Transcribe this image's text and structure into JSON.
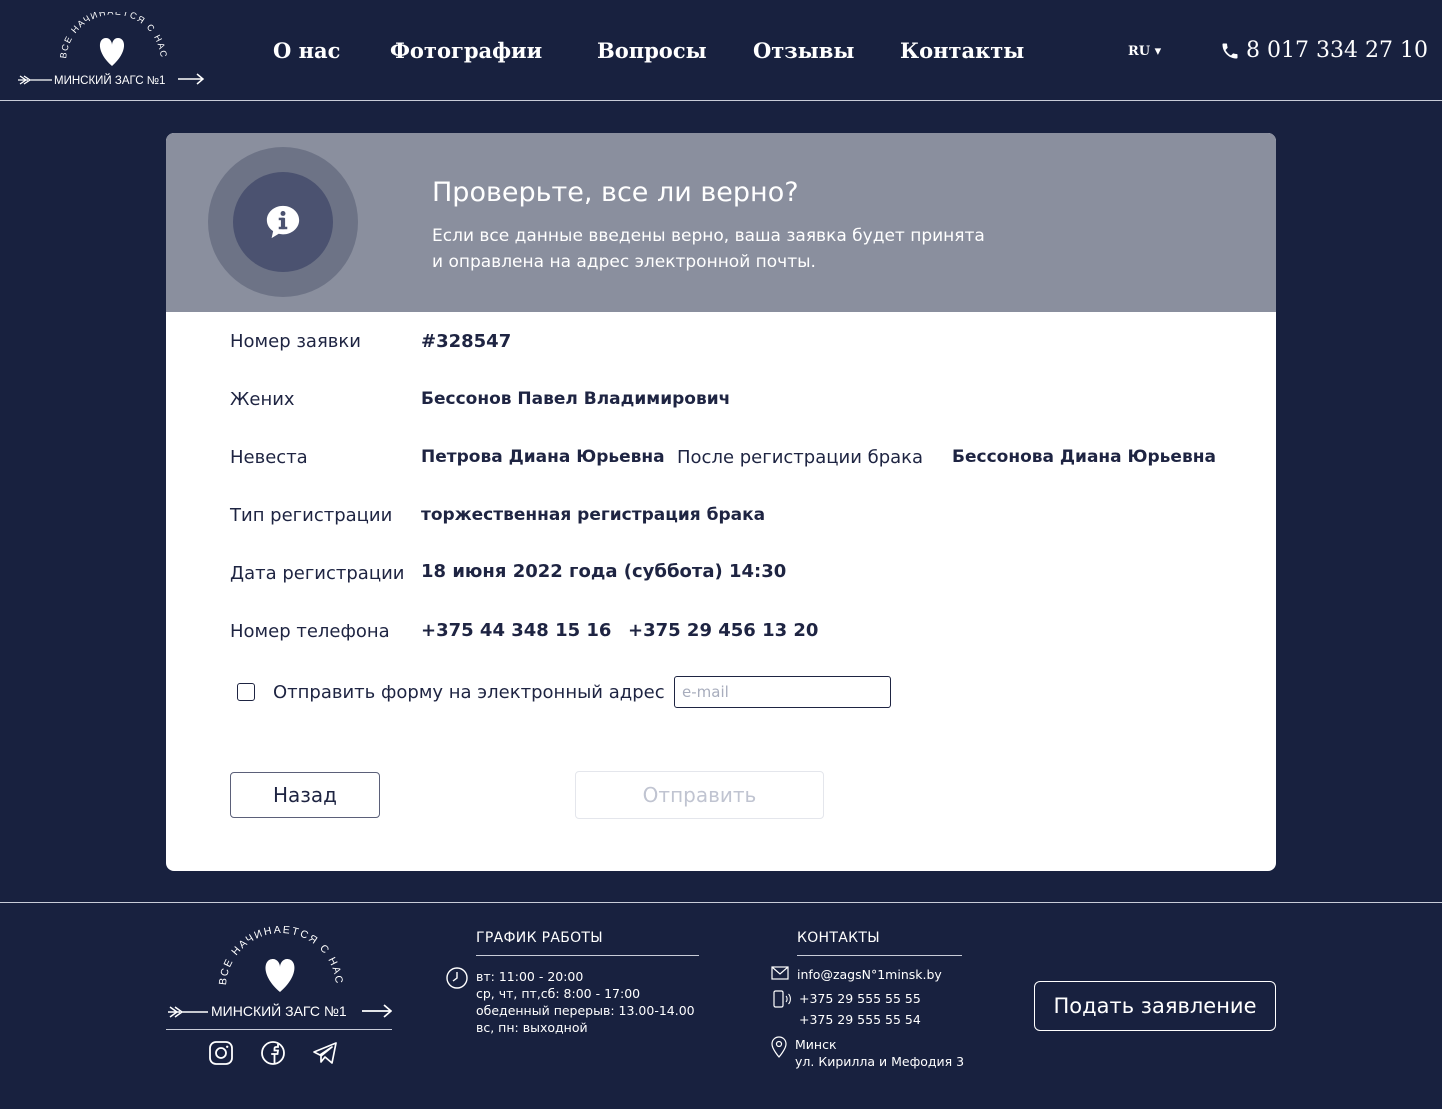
{
  "header": {
    "logo": {
      "top_text": "ВСЕ НАЧИНАЕТСЯ С НАС",
      "name": "МИНСКИЙ ЗАГС №1"
    },
    "nav": [
      {
        "label": "О нас"
      },
      {
        "label": "Фотографии"
      },
      {
        "label": "Вопросы"
      },
      {
        "label": "Отзывы"
      },
      {
        "label": "Контакты"
      }
    ],
    "language": "RU ▾",
    "phone": "8 017 334 27 10"
  },
  "confirm": {
    "title": "Проверьте, все ли верно?",
    "description_line1": "Если все данные введены верно, ваша заявка будет принята",
    "description_line2": "и оправлена на адрес электронной почты.",
    "rows": {
      "application_number": {
        "label": "Номер заявки",
        "value": "#328547"
      },
      "groom": {
        "label": "Жених",
        "value": "Бессонов Павел Владимирович"
      },
      "bride": {
        "label": "Невеста",
        "value": "Петрова Диана Юрьевна",
        "after_label": "После регистрации брака",
        "after_value": "Бессонова Диана Юрьевна"
      },
      "registration_type": {
        "label": "Тип регистрации",
        "value": "торжественная регистрация брака"
      },
      "registration_date": {
        "label": "Дата регистрации",
        "value": "18 июня 2022 года (суббота) 14:30"
      },
      "phone": {
        "label": "Номер телефона",
        "value1": "+375 44 348 15 16",
        "value2": "+375 29 456 13 20"
      }
    },
    "send_email": {
      "label": "Отправить форму на электронный адрес",
      "checked": false,
      "placeholder": "e-mail",
      "value": ""
    },
    "back_button": "Назад",
    "send_button": "Отправить"
  },
  "footer": {
    "logo": {
      "top_text": "ВСЕ НАЧИНАЕТСЯ С НАС",
      "name": "МИНСКИЙ ЗАГС №1"
    },
    "social": [
      "instagram-icon",
      "facebook-icon",
      "telegram-icon"
    ],
    "schedule": {
      "title": "ГРАФИК РАБОТЫ",
      "lines": [
        "вт: 11:00 - 20:00",
        "ср, чт, пт,сб: 8:00 - 17:00",
        "обеденный перерыв: 13.00-14.00",
        "вс, пн: выходной"
      ]
    },
    "contacts": {
      "title": "КОНТАКТЫ",
      "email": "info@zagsN°1minsk.by",
      "phone1": "+375 29 555 55 55",
      "phone2": "+375 29 555 55 54",
      "city": "Минск",
      "address": "ул. Кирилла и Мефодия 3"
    },
    "apply_button": "Подать заявление"
  },
  "colors": {
    "background": "#18213f",
    "banner": "#8a8f9e",
    "text_dark": "#1e2442"
  }
}
